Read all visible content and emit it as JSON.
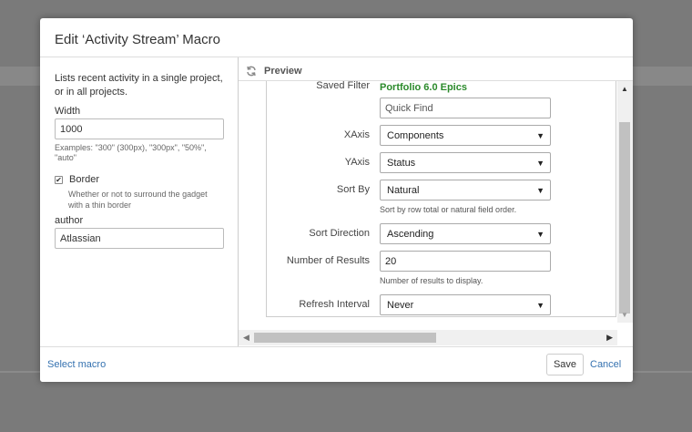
{
  "dialog": {
    "title": "Edit ‘Activity Stream’ Macro"
  },
  "left_panel": {
    "description": "Lists recent activity in a single project, or in all projects.",
    "width_label": "Width",
    "width_value": "1000",
    "width_hint": "Examples: \"300\" (300px), \"300px\", \"50%\", \"auto\"",
    "border_label": "Border",
    "border_checked": true,
    "border_hint": "Whether or not to surround the gadget with a thin border",
    "author_label": "author",
    "author_value": "Atlassian"
  },
  "preview": {
    "label": "Preview",
    "icon": "refresh-icon",
    "saved_filter_label": "Saved Filter",
    "saved_filter_value": "Portfolio 6.0 Epics",
    "quick_find_placeholder": "Quick Find",
    "xaxis_label": "XAxis",
    "xaxis_value": "Components",
    "yaxis_label": "YAxis",
    "yaxis_value": "Status",
    "sort_by_label": "Sort By",
    "sort_by_value": "Natural",
    "sort_by_hint": "Sort by row total or natural field order.",
    "sort_direction_label": "Sort Direction",
    "sort_direction_value": "Ascending",
    "num_results_label": "Number of Results",
    "num_results_value": "20",
    "num_results_hint": "Number of results to display.",
    "refresh_interval_label": "Refresh Interval",
    "refresh_interval_value": "Never",
    "dropdown_arrow": "▼",
    "scroll_up": "▲",
    "scroll_down": "▼",
    "scroll_left": "◀",
    "scroll_right": "▶"
  },
  "footer": {
    "select_macro": "Select macro",
    "save": "Save",
    "cancel": "Cancel"
  },
  "colors": {
    "link": "#3572b0",
    "filter_green": "#2b8a2b",
    "overlay": "#7a7a7a"
  }
}
